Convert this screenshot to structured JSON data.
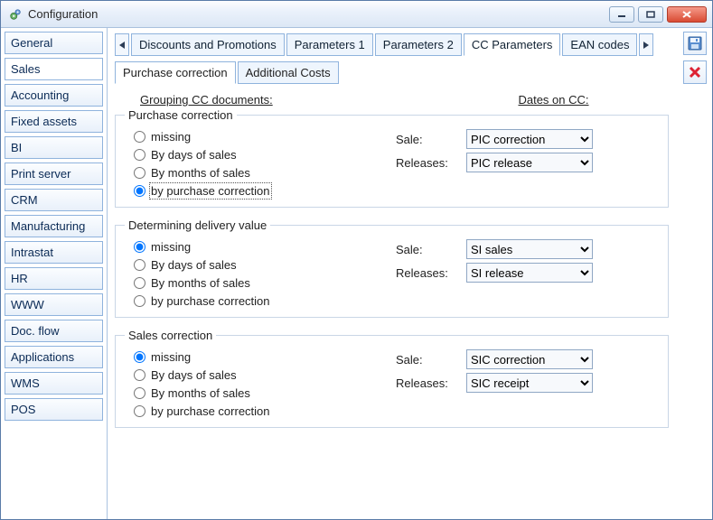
{
  "window": {
    "title": "Configuration"
  },
  "sidebar": {
    "items": [
      "General",
      "Sales",
      "Accounting",
      "Fixed assets",
      "BI",
      "Print server",
      "CRM",
      "Manufacturing",
      "Intrastat",
      "HR",
      "WWW",
      "Doc. flow",
      "Applications",
      "WMS",
      "POS"
    ],
    "selected_index": 1
  },
  "tabs": {
    "items": [
      "Discounts and Promotions",
      "Parameters 1",
      "Parameters 2",
      "CC Parameters",
      "EAN codes"
    ],
    "active_index": 3
  },
  "subtabs": {
    "items": [
      "Purchase correction",
      "Additional Costs"
    ],
    "active_index": 0
  },
  "headings": {
    "grouping": "Grouping CC documents:",
    "dates": "Dates on CC:"
  },
  "groups": [
    {
      "legend": "Purchase correction",
      "radios": [
        "missing",
        "By days of sales",
        "By months of sales",
        "by purchase correction"
      ],
      "selected_radio": 3,
      "selects": {
        "sale": {
          "label": "Sale:",
          "value": "PIC correction"
        },
        "release": {
          "label": "Releases:",
          "value": "PIC release"
        }
      }
    },
    {
      "legend": "Determining delivery value",
      "radios": [
        "missing",
        "By days of sales",
        "By months of sales",
        "by purchase correction"
      ],
      "selected_radio": 0,
      "selects": {
        "sale": {
          "label": "Sale:",
          "value": "SI sales"
        },
        "release": {
          "label": "Releases:",
          "value": "SI release"
        }
      }
    },
    {
      "legend": "Sales correction",
      "radios": [
        "missing",
        "By days of sales",
        "By months of sales",
        "by purchase correction"
      ],
      "selected_radio": 0,
      "selects": {
        "sale": {
          "label": "Sale:",
          "value": "SIC correction"
        },
        "release": {
          "label": "Releases:",
          "value": "SIC receipt"
        }
      }
    }
  ]
}
